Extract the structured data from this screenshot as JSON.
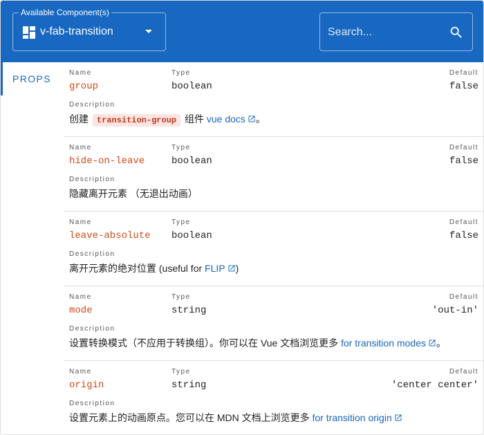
{
  "header": {
    "select": {
      "legend": "Available Component(s)",
      "value": "v-fab-transition",
      "icon": "dashboard-icon"
    },
    "search": {
      "placeholder": "Search...",
      "icon": "search-icon"
    },
    "accent_color": "#1867c0"
  },
  "tabs": [
    {
      "label": "PROPS",
      "active": true
    }
  ],
  "column_labels": {
    "name": "Name",
    "type": "Type",
    "default": "Default",
    "description": "Description"
  },
  "props": [
    {
      "name": "group",
      "type": "boolean",
      "default": "false",
      "description": {
        "before": "创建",
        "code": "transition-group",
        "middle": "组件",
        "link": "vue docs",
        "after": "。"
      }
    },
    {
      "name": "hide-on-leave",
      "type": "boolean",
      "default": "false",
      "description": {
        "text": "隐藏离开元素 （无退出动画）"
      }
    },
    {
      "name": "leave-absolute",
      "type": "boolean",
      "default": "false",
      "description": {
        "before": "离开元素的绝对位置 (useful for ",
        "link": "FLIP",
        "after": ")"
      }
    },
    {
      "name": "mode",
      "type": "string",
      "default": "'out-in'",
      "description": {
        "before": "设置转换模式（不应用于转换组）。你可以在 Vue 文档浏览更多 ",
        "link": "for transition modes",
        "after": "。"
      }
    },
    {
      "name": "origin",
      "type": "string",
      "default": "'center center'",
      "description": {
        "before": "设置元素上的动画原点。您可以在 MDN 文档上浏览更多 ",
        "link": "for transition origin",
        "after": ""
      }
    }
  ]
}
